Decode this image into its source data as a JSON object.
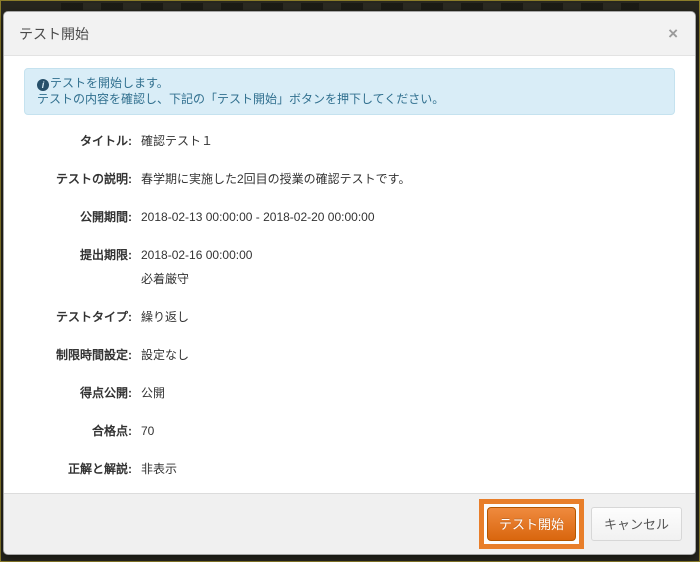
{
  "modal": {
    "title": "テスト開始",
    "close_label": "×",
    "alert": {
      "icon_glyph": "i",
      "icon_name": "info-icon",
      "line1": "テストを開始します。",
      "line2": "テストの内容を確認し、下記の「テスト開始」ボタンを押下してください。"
    },
    "fields": [
      {
        "label": "タイトル:",
        "value": "確認テスト１"
      },
      {
        "label": "テストの説明:",
        "value": "春学期に実施した2回目の授業の確認テストです。"
      },
      {
        "label": "公開期間:",
        "value": "2018-02-13 00:00:00 - 2018-02-20 00:00:00"
      },
      {
        "label": "提出期限:",
        "value": "2018-02-16 00:00:00",
        "value2": "必着厳守"
      },
      {
        "label": "テストタイプ:",
        "value": "繰り返し"
      },
      {
        "label": "制限時間設定:",
        "value": "設定なし"
      },
      {
        "label": "得点公開:",
        "value": "公開"
      },
      {
        "label": "合格点:",
        "value": "70"
      },
      {
        "label": "正解と解説:",
        "value": "非表示"
      }
    ],
    "footer": {
      "start_label": "テスト開始",
      "cancel_label": "キャンセル"
    }
  },
  "colors": {
    "accent_orange": "#e87e2a",
    "btn_orange_top": "#ef8a3e",
    "btn_orange_bottom": "#d9660e",
    "btn_orange_border": "#b35600",
    "info_bg": "#d9edf7",
    "info_border": "#c5e2ef",
    "info_text": "#31708f"
  }
}
